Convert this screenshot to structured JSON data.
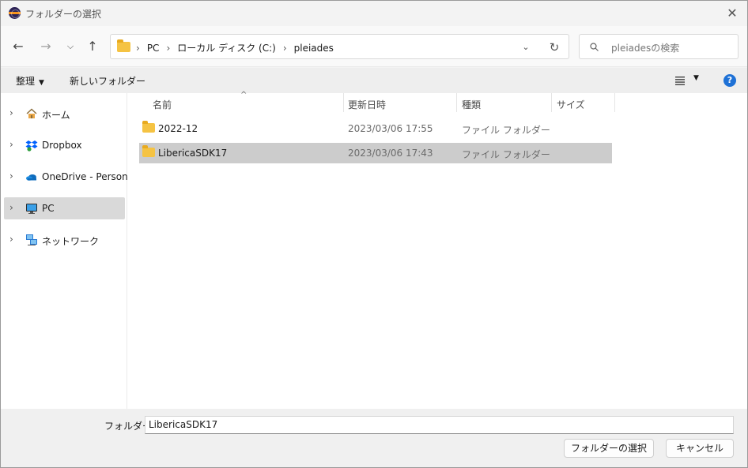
{
  "titlebar": {
    "title": "フォルダーの選択",
    "app_icon": "eclipse-icon",
    "close_icon": "close-icon"
  },
  "nav": {
    "back_icon": "arrow-left-icon",
    "forward_icon": "arrow-right-icon",
    "recent_icon": "chevron-down-icon",
    "up_icon": "arrow-up-icon",
    "breadcrumbs": [
      "PC",
      "ローカル ディスク (C:)",
      "pleiades"
    ],
    "search_placeholder": "pleiadesの検索"
  },
  "commands": {
    "organize": "整理",
    "new_folder": "新しいフォルダー"
  },
  "sidebar": {
    "items": [
      {
        "label": "ホーム",
        "icon": "home-icon"
      },
      {
        "label": "Dropbox",
        "icon": "dropbox-icon"
      },
      {
        "label": "OneDrive - Personal",
        "icon": "onedrive-icon"
      },
      {
        "label": "PC",
        "icon": "pc-icon",
        "selected": true
      },
      {
        "label": "ネットワーク",
        "icon": "network-icon"
      }
    ]
  },
  "list": {
    "columns": {
      "name": "名前",
      "modified": "更新日時",
      "type": "種類",
      "size": "サイズ"
    },
    "rows": [
      {
        "name": "2022-12",
        "modified": "2023/03/06 17:55",
        "type": "ファイル フォルダー"
      },
      {
        "name": "LibericaSDK17",
        "modified": "2023/03/06 17:43",
        "type": "ファイル フォルダー",
        "selected": true
      }
    ]
  },
  "bottom": {
    "folder_label": "フォルダー:",
    "folder_value": "LibericaSDK17",
    "select_button": "フォルダーの選択",
    "cancel_button": "キャンセル"
  },
  "colors": {
    "accent": "#1e71d6",
    "folder": "#f5c343",
    "selection": "#cccccc"
  }
}
